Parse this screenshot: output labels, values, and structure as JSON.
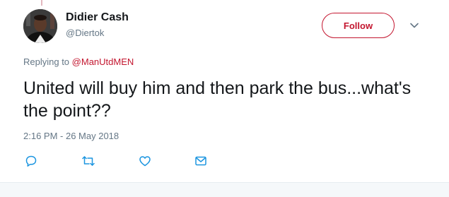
{
  "user": {
    "display_name": "Didier Cash",
    "handle": "@Diertok"
  },
  "follow_label": "Follow",
  "reply_context": {
    "prefix": "Replying to",
    "mention": "@ManUtdMEN"
  },
  "tweet": {
    "text": "United will buy him and then park the bus...what's the point??",
    "timestamp": "2:16 PM - 26 May 2018"
  },
  "colors": {
    "accent": "#c3162f",
    "text": "#14171a",
    "muted": "#657786"
  },
  "icons": {
    "more": "chevron-down-icon",
    "reply": "reply-icon",
    "retweet": "retweet-icon",
    "like": "heart-icon",
    "message": "envelope-icon"
  }
}
